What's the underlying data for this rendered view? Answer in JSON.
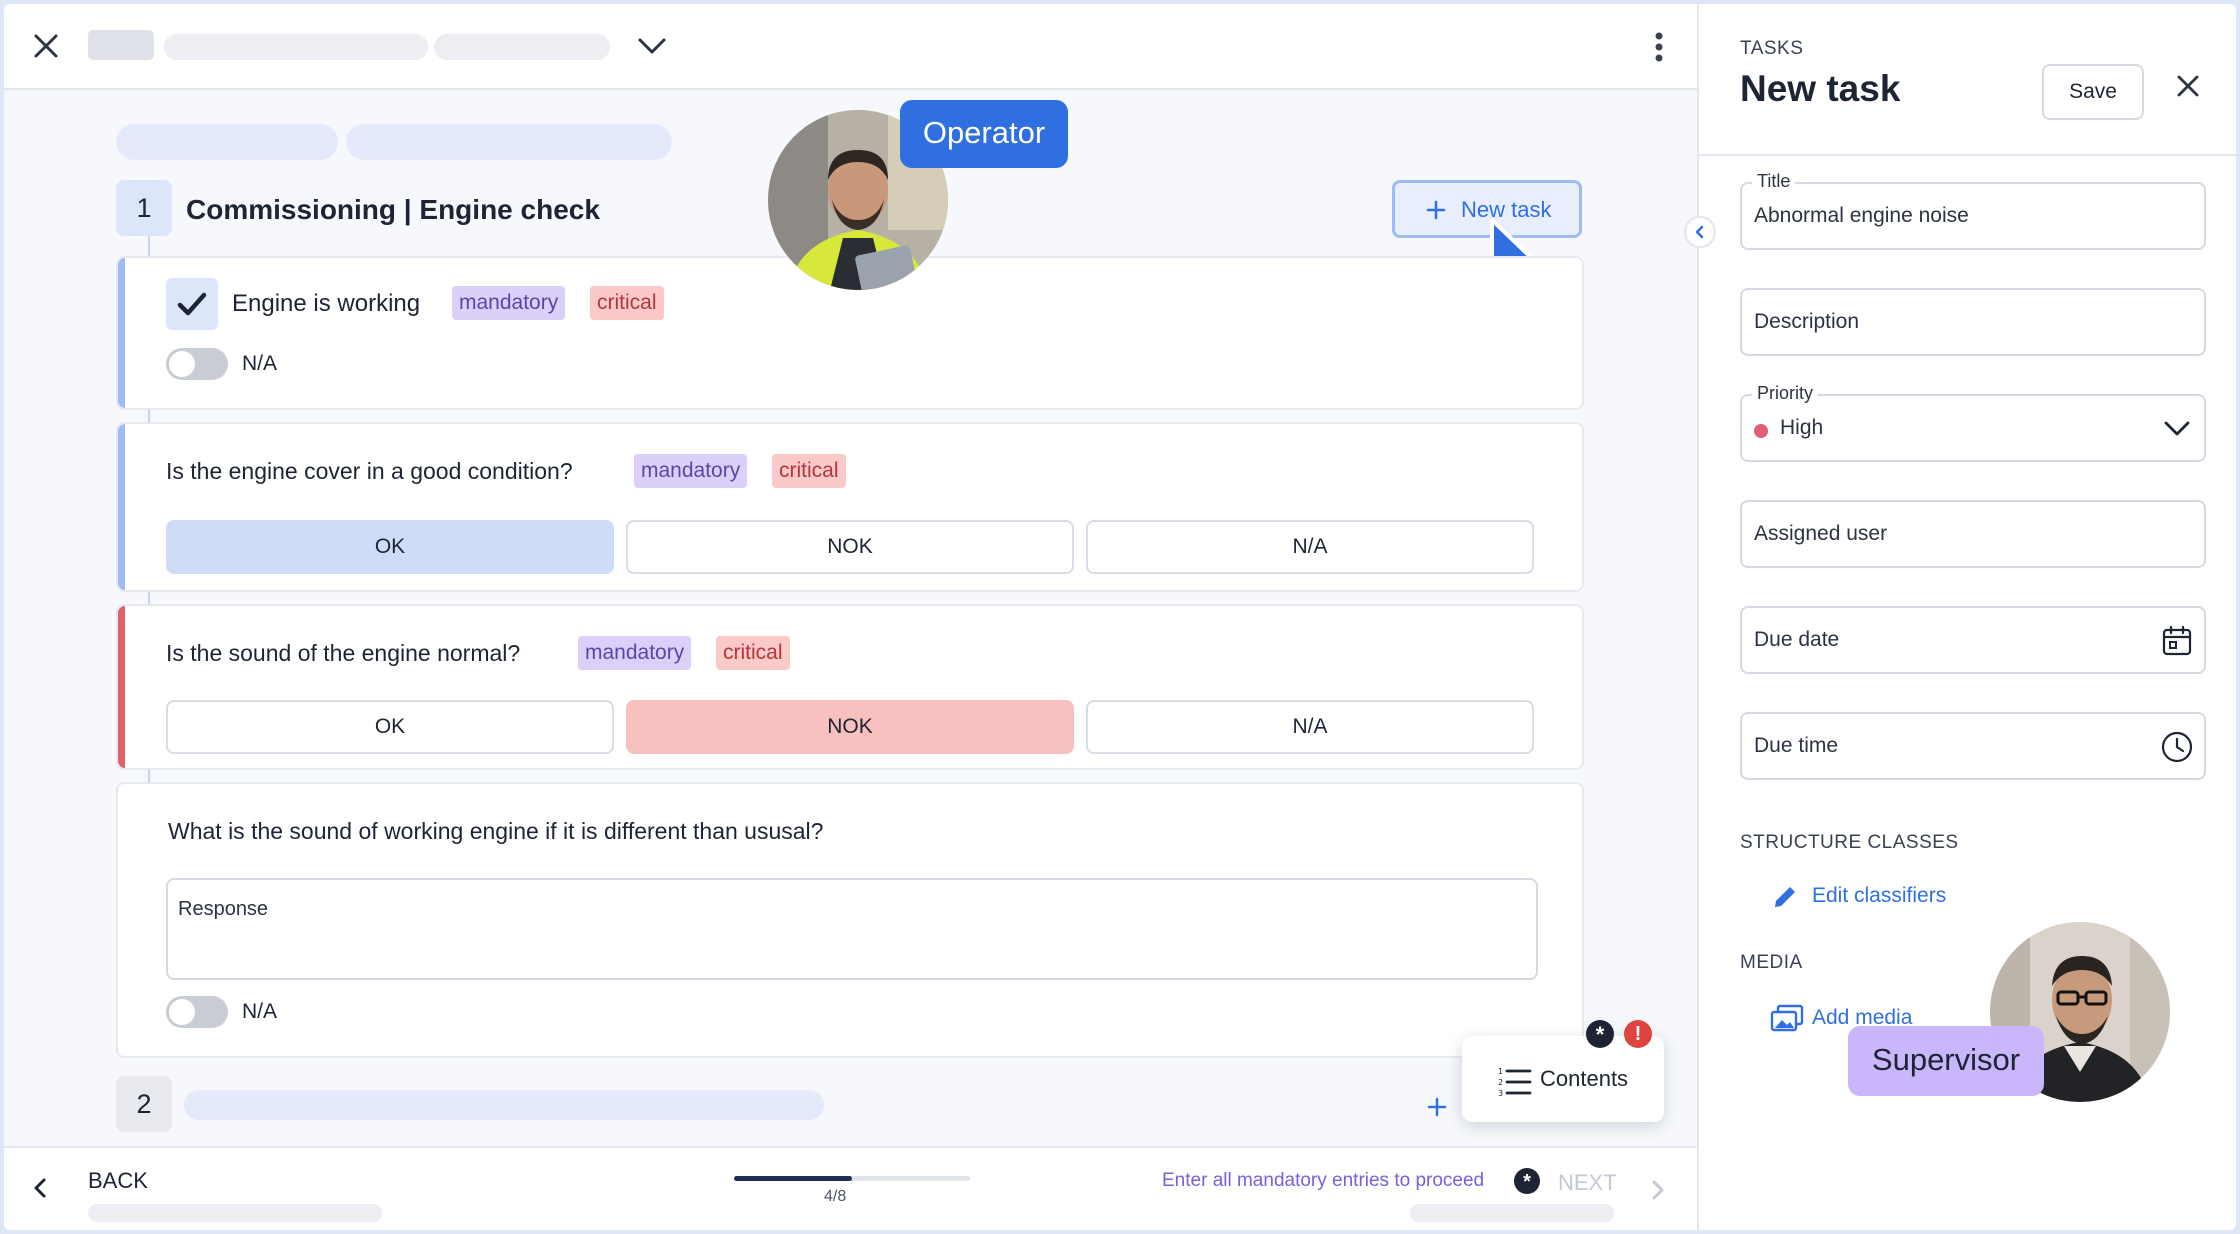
{
  "header": {
    "close_icon": "close-icon",
    "dropdown_icon": "chevron-down-icon",
    "menu_icon": "more-vertical-icon"
  },
  "section1": {
    "number": "1",
    "title": "Commissioning | Engine check",
    "new_task_label": "New task"
  },
  "section2": {
    "number": "2"
  },
  "operator_label": "Operator",
  "supervisor_label": "Supervisor",
  "questions": [
    {
      "text": "Engine is working",
      "tags": [
        "mandatory",
        "critical"
      ],
      "checked": true,
      "na_label": "N/A"
    },
    {
      "text": "Is the engine cover in a good condition?",
      "tags": [
        "mandatory",
        "critical"
      ],
      "options": [
        "OK",
        "NOK",
        "N/A"
      ],
      "selected": "OK"
    },
    {
      "text": "Is the sound of the engine normal?",
      "tags": [
        "mandatory",
        "critical"
      ],
      "options": [
        "OK",
        "NOK",
        "N/A"
      ],
      "selected": "NOK"
    },
    {
      "text": "What is the sound of working engine if it is different than ususal?",
      "placeholder": "Response",
      "na_label": "N/A"
    }
  ],
  "contents_label": "Contents",
  "footer": {
    "back_label": "BACK",
    "progress_text": "4/8",
    "progress": 0.5,
    "hint": "Enter all mandatory entries to proceed",
    "next_label": "NEXT"
  },
  "panel": {
    "overline": "TASKS",
    "title": "New task",
    "save_label": "Save",
    "fields": {
      "title_label": "Title",
      "title_value": "Abnormal engine noise",
      "description": "Description",
      "priority_label": "Priority",
      "priority_value": "High",
      "assigned_user": "Assigned user",
      "due_date": "Due date",
      "due_time": "Due time"
    },
    "structure_label": "STRUCTURE CLASSES",
    "edit_classifiers": "Edit classifiers",
    "media_label": "MEDIA",
    "add_media": "Add media"
  },
  "colors": {
    "accent": "#2f6fe0",
    "critical": "#e0606e",
    "mandatory_bg": "#dcd0fb",
    "critical_bg": "#fcc9c9",
    "priority_high": "#e0607a"
  }
}
